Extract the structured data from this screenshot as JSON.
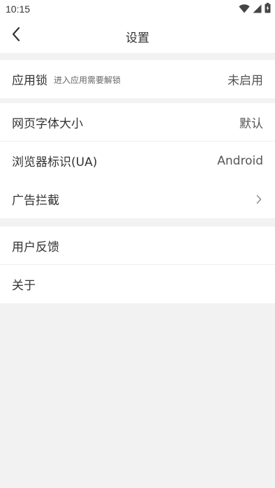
{
  "status_bar": {
    "time": "10:15",
    "icons": [
      "wifi-icon",
      "signal-icon",
      "battery-icon"
    ]
  },
  "header": {
    "title": "设置",
    "back_icon": "back-arrow-icon"
  },
  "sections": {
    "app_lock": {
      "label": "应用锁",
      "hint": "进入应用需要解锁",
      "value": "未启用"
    },
    "font_size": {
      "label": "网页字体大小",
      "value": "默认"
    },
    "user_agent": {
      "label": "浏览器标识(UA)",
      "value": "Android"
    },
    "ad_block": {
      "label": "广告拦截"
    },
    "feedback": {
      "label": "用户反馈"
    },
    "about": {
      "label": "关于"
    }
  },
  "colors": {
    "background": "#f2f2f2",
    "card": "#ffffff",
    "text": "#333333",
    "divider": "#efefef"
  }
}
